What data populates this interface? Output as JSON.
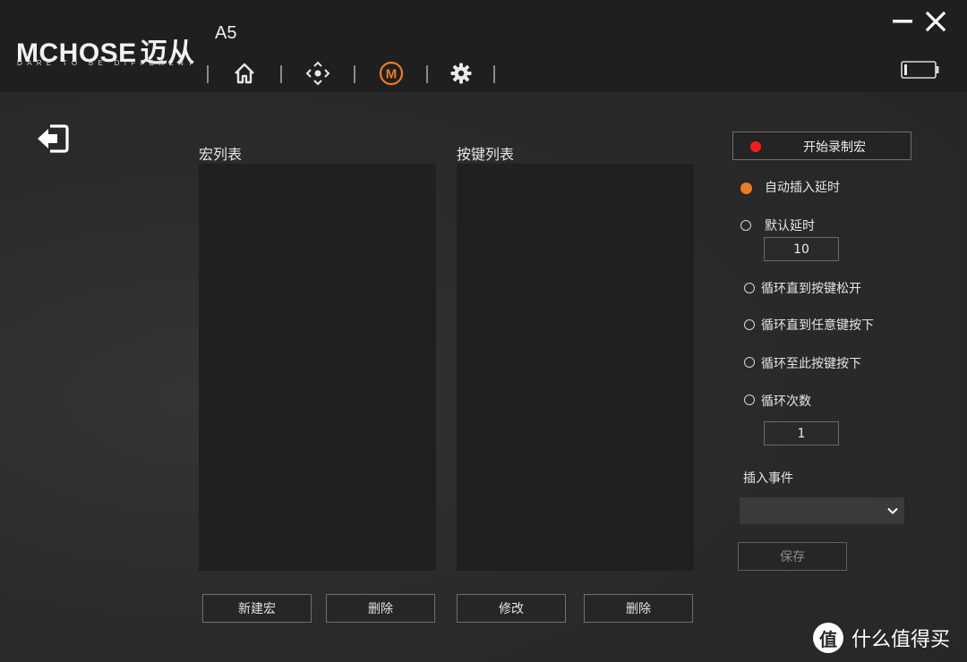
{
  "header": {
    "brand": "MCHOSE",
    "brand_cn": "迈从",
    "tagline": "DARE TO BE DIFFERENT",
    "model": "A5",
    "nav": [
      {
        "icon": "home-icon"
      },
      {
        "icon": "dpad-icon"
      },
      {
        "icon": "macro-icon",
        "label": "M",
        "active": true
      },
      {
        "icon": "gear-icon"
      }
    ],
    "battery_icon": "battery-icon"
  },
  "colors": {
    "accent": "#f07a24",
    "record": "#ff1a1a",
    "header_bg": "#1f1f1f",
    "list_bg": "#202020"
  },
  "macro_list": {
    "label": "宏列表",
    "items": [],
    "buttons": {
      "new": "新建宏",
      "delete": "删除"
    }
  },
  "key_list": {
    "label": "按键列表",
    "items": [],
    "buttons": {
      "edit": "修改",
      "delete": "删除"
    }
  },
  "options": {
    "record_label": "开始录制宏",
    "delay_options": [
      {
        "label": "自动插入延时",
        "selected": true
      },
      {
        "label": "默认延时",
        "selected": false
      }
    ],
    "default_delay_value": "10",
    "loop_options": [
      {
        "label": "循环直到按键松开",
        "selected": false
      },
      {
        "label": "循环直到任意键按下",
        "selected": false
      },
      {
        "label": "循环至此按键按下",
        "selected": false
      },
      {
        "label": "循环次数",
        "selected": false
      }
    ],
    "loop_count_value": "1",
    "insert_event_label": "插入事件",
    "insert_event_value": "",
    "save_label": "保存"
  },
  "watermark": {
    "badge": "值",
    "text": "什么值得买"
  }
}
